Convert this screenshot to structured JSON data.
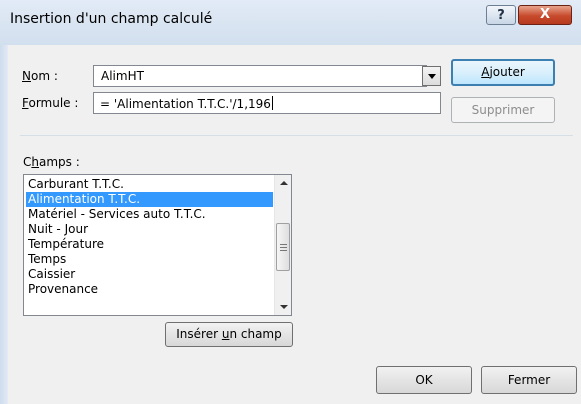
{
  "window": {
    "title": "Insertion d'un champ calculé",
    "help_label": "?",
    "close_label": "X"
  },
  "nom": {
    "label_accel": "N",
    "label_rest": "om :",
    "value": "AlimHT"
  },
  "formule": {
    "label_accel": "F",
    "label_rest": "ormule :",
    "value": "= 'Alimentation T.T.C.'/1,196"
  },
  "buttons": {
    "ajouter_accel": "A",
    "ajouter_rest": "jouter",
    "supprimer": "Supprimer",
    "inserer_pre": "Insérer ",
    "inserer_accel": "u",
    "inserer_post": "n champ",
    "ok": "OK",
    "fermer": "Fermer"
  },
  "champs": {
    "label_pre": "C",
    "label_accel": "h",
    "label_post": "amps :",
    "items": [
      "Carburant T.T.C.",
      "Alimentation T.T.C.",
      "Matériel - Services auto T.T.C.",
      "Nuit - Jour",
      "Température",
      "Temps",
      "Caissier",
      "Provenance"
    ],
    "selected_index": 1
  }
}
